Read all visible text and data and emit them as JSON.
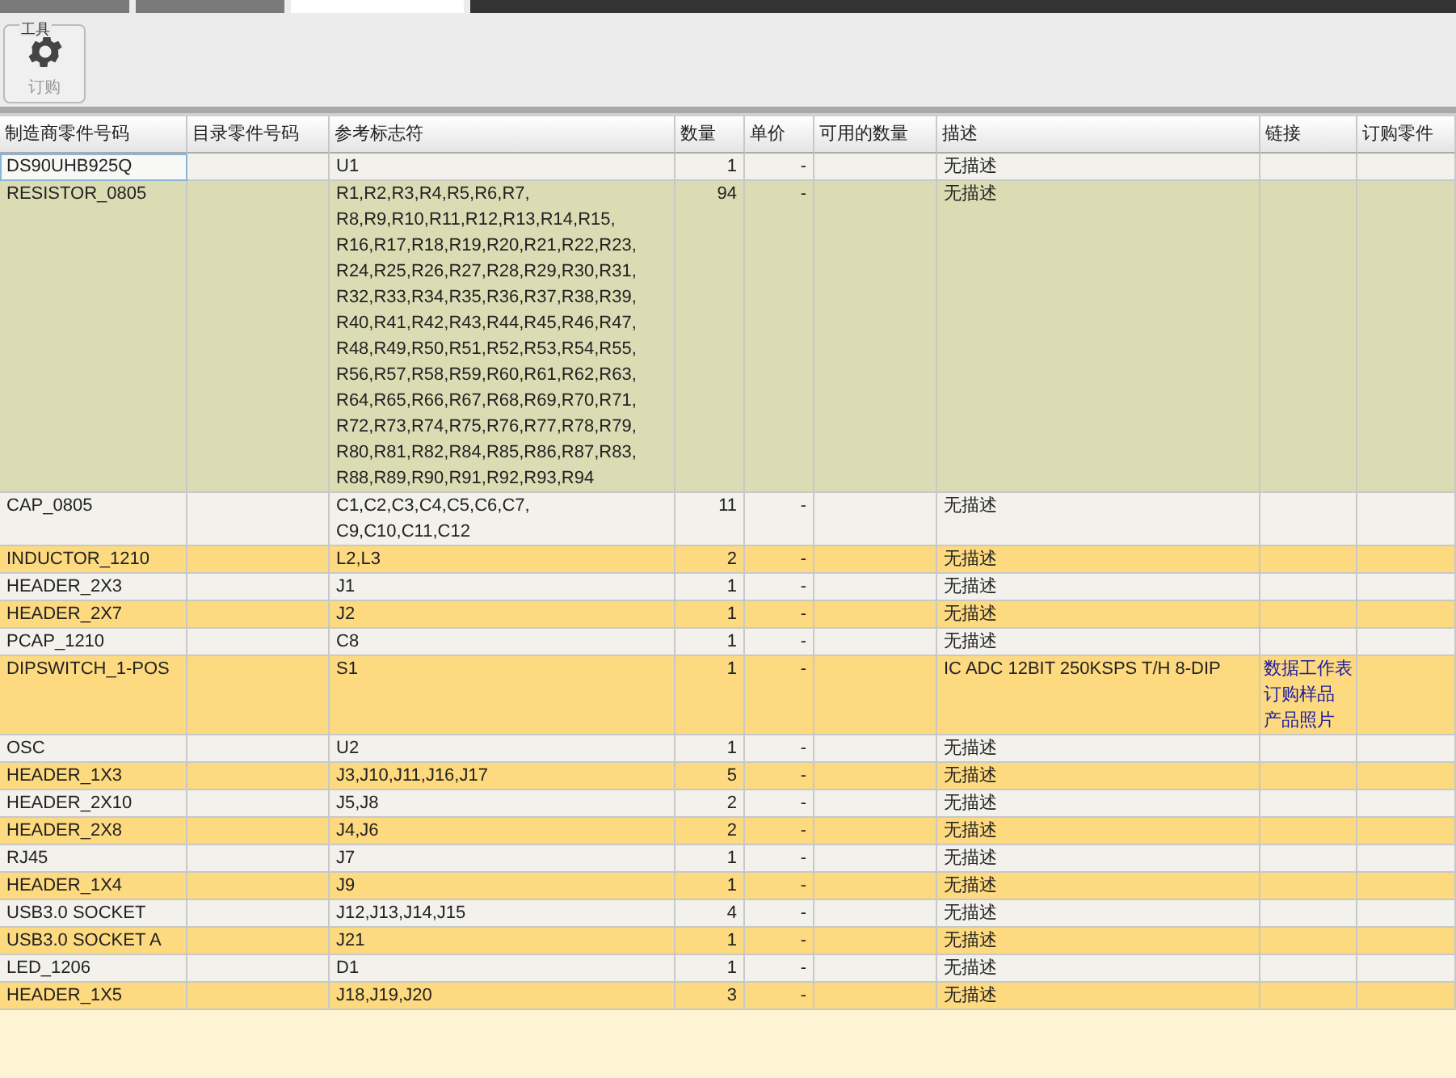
{
  "tabs": [
    {
      "selected": false
    },
    {
      "selected": false
    },
    {
      "selected": true
    }
  ],
  "toolbar": {
    "group_label": "工具",
    "button": {
      "label": "订购",
      "disabled": true
    }
  },
  "table": {
    "columns": [
      "制造商零件号码",
      "目录零件号码",
      "参考标志符",
      "数量",
      "单价",
      "可用的数量",
      "描述",
      "链接",
      "订购零件"
    ],
    "rows": [
      {
        "mfr_part": "DS90UHB925Q",
        "refs": "U1",
        "qty": "1",
        "price": "-",
        "description": "无描述",
        "selected": false,
        "focused": true
      },
      {
        "mfr_part": "RESISTOR_0805",
        "refs": "R1,R2,R3,R4,R5,R6,R7,\nR8,R9,R10,R11,R12,R13,R14,R15,\nR16,R17,R18,R19,R20,R21,R22,R23,\nR24,R25,R26,R27,R28,R29,R30,R31,\nR32,R33,R34,R35,R36,R37,R38,R39,\nR40,R41,R42,R43,R44,R45,R46,R47,\nR48,R49,R50,R51,R52,R53,R54,R55,\nR56,R57,R58,R59,R60,R61,R62,R63,\nR64,R65,R66,R67,R68,R69,R70,R71,\nR72,R73,R74,R75,R76,R77,R78,R79,\nR80,R81,R82,R84,R85,R86,R87,R83,\nR88,R89,R90,R91,R92,R93,R94",
        "qty": "94",
        "price": "-",
        "description": "无描述",
        "selected": true,
        "focused": false
      },
      {
        "mfr_part": "CAP_0805",
        "refs": "C1,C2,C3,C4,C5,C6,C7,\nC9,C10,C11,C12",
        "qty": "11",
        "price": "-",
        "description": "无描述",
        "selected": false,
        "focused": false
      },
      {
        "mfr_part": "INDUCTOR_1210",
        "refs": "L2,L3",
        "qty": "2",
        "price": "-",
        "description": "无描述",
        "selected": false,
        "focused": false
      },
      {
        "mfr_part": "HEADER_2X3",
        "refs": "J1",
        "qty": "1",
        "price": "-",
        "description": "无描述",
        "selected": false,
        "focused": false
      },
      {
        "mfr_part": "HEADER_2X7",
        "refs": "J2",
        "qty": "1",
        "price": "-",
        "description": "无描述",
        "selected": false,
        "focused": false
      },
      {
        "mfr_part": "PCAP_1210",
        "refs": "C8",
        "qty": "1",
        "price": "-",
        "description": "无描述",
        "selected": false,
        "focused": false
      },
      {
        "mfr_part": "DIPSWITCH_1-POS",
        "refs": "S1",
        "qty": "1",
        "price": "-",
        "description": "IC ADC 12BIT 250KSPS T/H 8-DIP",
        "links": [
          "数据工作表",
          "订购样品",
          "产品照片"
        ],
        "selected": false,
        "focused": false
      },
      {
        "mfr_part": "OSC",
        "refs": "U2",
        "qty": "1",
        "price": "-",
        "description": "无描述",
        "selected": false,
        "focused": false
      },
      {
        "mfr_part": "HEADER_1X3",
        "refs": "J3,J10,J11,J16,J17",
        "qty": "5",
        "price": "-",
        "description": "无描述",
        "selected": false,
        "focused": false
      },
      {
        "mfr_part": "HEADER_2X10",
        "refs": "J5,J8",
        "qty": "2",
        "price": "-",
        "description": "无描述",
        "selected": false,
        "focused": false
      },
      {
        "mfr_part": "HEADER_2X8",
        "refs": "J4,J6",
        "qty": "2",
        "price": "-",
        "description": "无描述",
        "selected": false,
        "focused": false
      },
      {
        "mfr_part": "RJ45",
        "refs": "J7",
        "qty": "1",
        "price": "-",
        "description": "无描述",
        "selected": false,
        "focused": false
      },
      {
        "mfr_part": "HEADER_1X4",
        "refs": "J9",
        "qty": "1",
        "price": "-",
        "description": "无描述",
        "selected": false,
        "focused": false
      },
      {
        "mfr_part": "USB3.0 SOCKET",
        "refs": "J12,J13,J14,J15",
        "qty": "4",
        "price": "-",
        "description": "无描述",
        "selected": false,
        "focused": false
      },
      {
        "mfr_part": "USB3.0 SOCKET A",
        "refs": "J21",
        "qty": "1",
        "price": "-",
        "description": "无描述",
        "selected": false,
        "focused": false
      },
      {
        "mfr_part": "LED_1206",
        "refs": "D1",
        "qty": "1",
        "price": "-",
        "description": "无描述",
        "selected": false,
        "focused": false
      },
      {
        "mfr_part": "HEADER_1X5",
        "refs": "J18,J19,J20",
        "qty": "3",
        "price": "-",
        "description": "无描述",
        "selected": false,
        "focused": false
      }
    ]
  }
}
